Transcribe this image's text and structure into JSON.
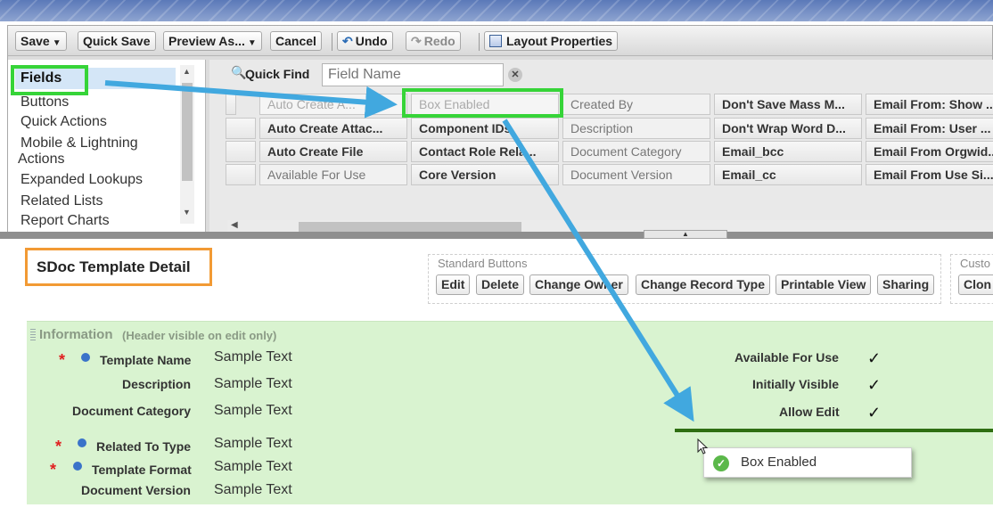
{
  "toolbar": {
    "save": "Save",
    "quick_save": "Quick Save",
    "preview_as": "Preview As...",
    "cancel": "Cancel",
    "undo": "Undo",
    "redo": "Redo",
    "layout_properties": "Layout Properties"
  },
  "palette": {
    "categories": [
      "Fields",
      "Buttons",
      "Quick Actions",
      "Mobile & Lightning",
      "Actions",
      "Expanded Lookups",
      "Related Lists",
      "Report Charts"
    ],
    "quick_find_label": "Quick Find",
    "quick_find_placeholder": "Field Name",
    "field_rows": [
      [
        "Auto Create A...",
        "Box Enabled",
        "Created By",
        "Don't Save Mass M...",
        "Email From: Show ..."
      ],
      [
        "Auto Create Attac...",
        "Component IDs",
        "Description",
        "Don't Wrap Word D...",
        "Email From: User ..."
      ],
      [
        "Auto Create File",
        "Contact Role Rela...",
        "Document Category",
        "Email_bcc",
        "Email From Orgwid..."
      ],
      [
        "Available For Use",
        "Core Version",
        "Document Version",
        "Email_cc",
        "Email From Use Si..."
      ]
    ]
  },
  "layout": {
    "section_title": "SDoc Template Detail",
    "standard_buttons_legend": "Standard Buttons",
    "standard_buttons": [
      "Edit",
      "Delete",
      "Change Owner",
      "Change Record Type",
      "Printable View",
      "Sharing"
    ],
    "custom_buttons_legend": "Custo",
    "custom_button": "Clon",
    "info_header": "Information",
    "info_subheader": "(Header visible on edit only)",
    "left_fields": [
      {
        "label": "Template Name",
        "value": "Sample Text"
      },
      {
        "label": "Description",
        "value": "Sample Text"
      },
      {
        "label": "Document Category",
        "value": "Sample Text"
      },
      {
        "label": "Related To Type",
        "value": "Sample Text"
      },
      {
        "label": "Template Format",
        "value": "Sample Text"
      },
      {
        "label": "Document Version",
        "value": "Sample Text"
      }
    ],
    "right_fields": [
      {
        "label": "Available For Use",
        "value": "✓"
      },
      {
        "label": "Initially Visible",
        "value": "✓"
      },
      {
        "label": "Allow Edit",
        "value": "✓"
      }
    ],
    "drag_item": "Box Enabled"
  },
  "colors": {
    "highlight_green": "#36d438",
    "arrow_blue": "#41a8df",
    "section_orange": "#f29a34",
    "info_background": "#d9f3d0",
    "drop_line": "#2f6e12"
  },
  "icons": [
    "search-icon",
    "clear-icon",
    "undo-icon",
    "redo-icon",
    "layout-properties-icon",
    "check-icon",
    "success-icon",
    "cursor-icon"
  ]
}
